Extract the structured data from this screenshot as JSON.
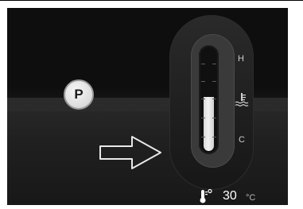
{
  "gear_indicator": {
    "label": "P"
  },
  "gauge": {
    "high_label": "H",
    "low_label": "C",
    "fill_fraction": 0.53,
    "icon": "coolant-temperature-icon"
  },
  "temperature": {
    "icon": "thermometer-icon",
    "value": "30",
    "unit": "°C"
  },
  "arrow": {
    "icon": "right-arrow-outline-icon"
  },
  "colors": {
    "background": "#0e0e0e",
    "fill": "#e6e6e6",
    "label": "#cfcfcf"
  }
}
